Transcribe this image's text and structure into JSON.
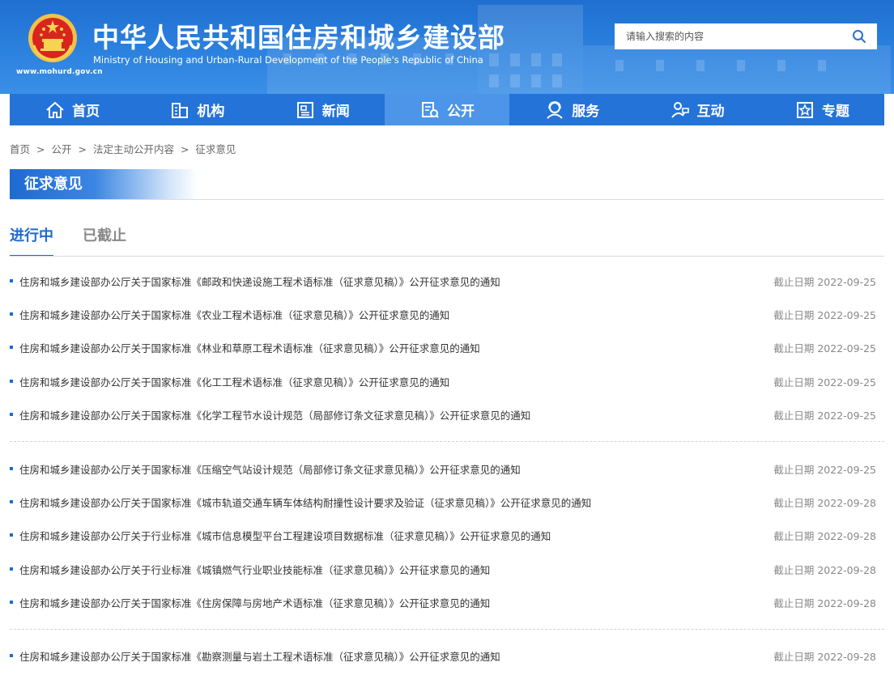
{
  "header": {
    "title_cn": "中华人民共和国住房和城乡建设部",
    "title_en": "Ministry of Housing and Urban-Rural Development of the People's Republic of China",
    "site_url": "www.mohurd.gov.cn",
    "search_placeholder": "请输入搜索的内容"
  },
  "nav": [
    {
      "label": "首页",
      "icon": "home-icon"
    },
    {
      "label": "机构",
      "icon": "org-icon"
    },
    {
      "label": "新闻",
      "icon": "news-icon"
    },
    {
      "label": "公开",
      "icon": "public-icon",
      "active": true
    },
    {
      "label": "服务",
      "icon": "service-icon"
    },
    {
      "label": "互动",
      "icon": "interact-icon"
    },
    {
      "label": "专题",
      "icon": "topic-icon"
    }
  ],
  "breadcrumb": [
    "首页",
    "公开",
    "法定主动公开内容",
    "征求意见"
  ],
  "breadcrumb_sep": ">",
  "section_title": "征求意见",
  "tabs": [
    {
      "label": "进行中",
      "active": true
    },
    {
      "label": "已截止",
      "active": false
    }
  ],
  "date_prefix": "截止日期",
  "items": [
    {
      "title": "住房和城乡建设部办公厅关于国家标准《邮政和快递设施工程术语标准（征求意见稿）》公开征求意见的通知",
      "date": "2022-09-25"
    },
    {
      "title": "住房和城乡建设部办公厅关于国家标准《农业工程术语标准（征求意见稿）》公开征求意见的通知",
      "date": "2022-09-25"
    },
    {
      "title": "住房和城乡建设部办公厅关于国家标准《林业和草原工程术语标准（征求意见稿）》公开征求意见的通知",
      "date": "2022-09-25"
    },
    {
      "title": "住房和城乡建设部办公厅关于国家标准《化工工程术语标准（征求意见稿）》公开征求意见的通知",
      "date": "2022-09-25"
    },
    {
      "title": "住房和城乡建设部办公厅关于国家标准《化学工程节水设计规范（局部修订条文征求意见稿）》公开征求意见的通知",
      "date": "2022-09-25"
    },
    {
      "title": "住房和城乡建设部办公厅关于国家标准《压缩空气站设计规范（局部修订条文征求意见稿）》公开征求意见的通知",
      "date": "2022-09-25"
    },
    {
      "title": "住房和城乡建设部办公厅关于国家标准《城市轨道交通车辆车体结构耐撞性设计要求及验证（征求意见稿）》公开征求意见的通知",
      "date": "2022-09-28"
    },
    {
      "title": "住房和城乡建设部办公厅关于行业标准《城市信息模型平台工程建设项目数据标准（征求意见稿）》公开征求意见的通知",
      "date": "2022-09-28"
    },
    {
      "title": "住房和城乡建设部办公厅关于行业标准《城镇燃气行业职业技能标准（征求意见稿）》公开征求意见的通知",
      "date": "2022-09-28"
    },
    {
      "title": "住房和城乡建设部办公厅关于国家标准《住房保障与房地产术语标准（征求意见稿）》公开征求意见的通知",
      "date": "2022-09-28"
    },
    {
      "title": "住房和城乡建设部办公厅关于国家标准《勘察测量与岩土工程术语标准（征求意见稿）》公开征求意见的通知",
      "date": "2022-09-28"
    }
  ]
}
